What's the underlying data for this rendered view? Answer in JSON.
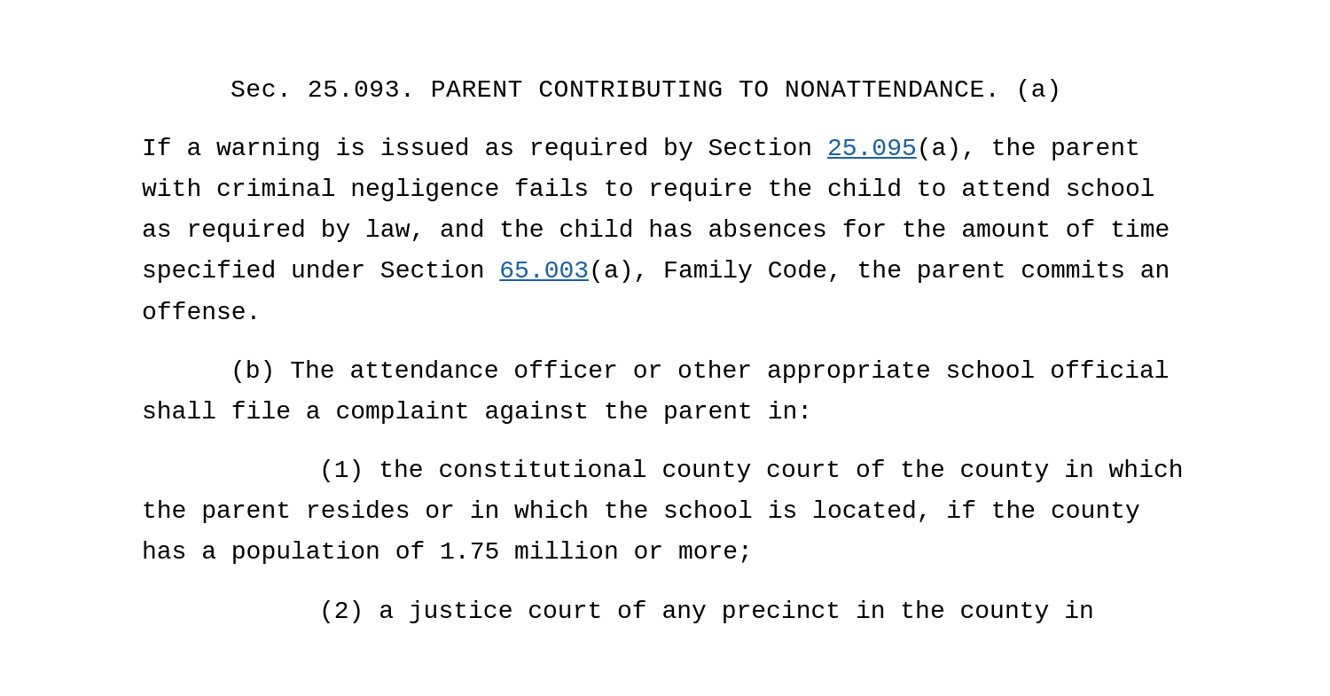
{
  "document": {
    "section_header": "Sec. 25.093.   PARENT CONTRIBUTING TO NONATTENDANCE.   (a)",
    "paragraph_a": "If a warning is issued as required by Section ",
    "link1_text": "25.095",
    "link1_href": "#25.095",
    "paragraph_a_cont": "(a),  the parent with criminal negligence fails to require the child to attend school as required by law,  and the child has absences for the amount of time specified under Section ",
    "link2_text": "65.003",
    "link2_href": "#65.003",
    "paragraph_a_end": "(a),  Family Code,  the parent commits an offense.",
    "paragraph_b_intro": "(b)   The attendance officer or other appropriate school official shall file a complaint against the parent in:",
    "item_1_intro": "(1)   the constitutional county court of the county in which the parent resides or in which the school is located,  if the county has a population of 1.75 million or more;",
    "item_2_intro": "(2)   a justice court of any precinct in the county in"
  }
}
